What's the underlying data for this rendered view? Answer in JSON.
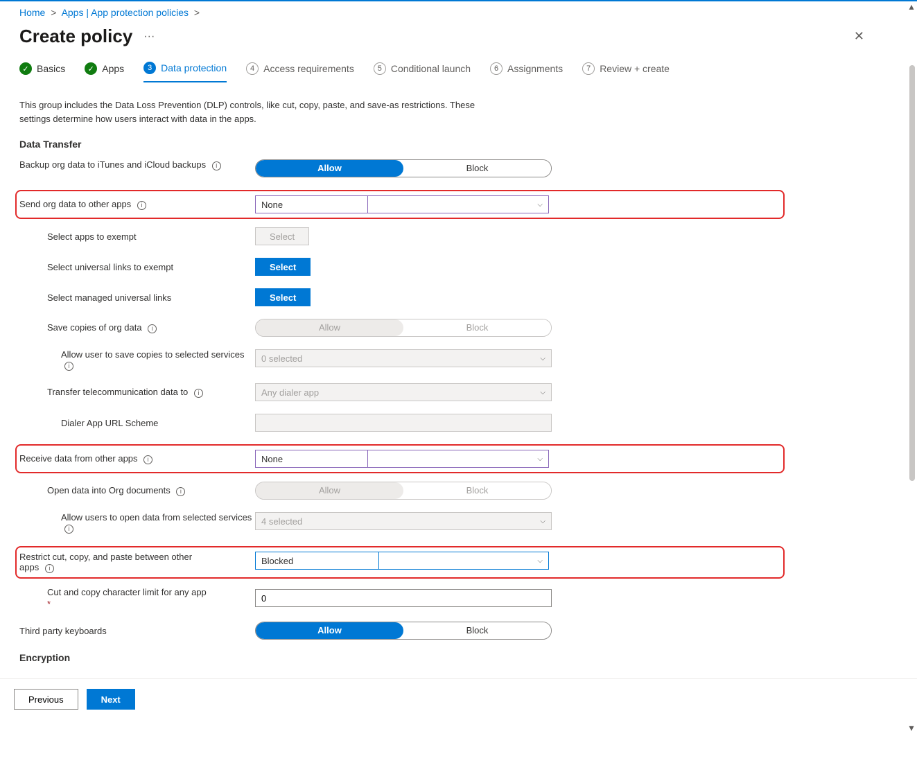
{
  "breadcrumb": {
    "home": "Home",
    "apps": "Apps | App protection policies"
  },
  "header": {
    "title": "Create policy"
  },
  "wizard": {
    "s1": "Basics",
    "s2": "Apps",
    "s3": "Data protection",
    "s4": "Access requirements",
    "s5": "Conditional launch",
    "s6": "Assignments",
    "s7": "Review + create",
    "n4": "4",
    "n5": "5",
    "n6": "6",
    "n7": "7",
    "n3": "3"
  },
  "desc": "This group includes the Data Loss Prevention (DLP) controls, like cut, copy, paste, and save-as restrictions. These settings determine how users interact with data in the apps.",
  "section": {
    "dataTransfer": "Data Transfer",
    "encryption": "Encryption"
  },
  "labels": {
    "backup": "Backup org data to iTunes and iCloud backups",
    "sendOrg": "Send org data to other apps",
    "appsExempt": "Select apps to exempt",
    "ulinksExempt": "Select universal links to exempt",
    "managedUlinks": "Select managed universal links",
    "saveCopies": "Save copies of org data",
    "allowSaveServices": "Allow user to save copies to selected services",
    "transferTele": "Transfer telecommunication data to",
    "dialerUrl": "Dialer App URL Scheme",
    "receiveData": "Receive data from other apps",
    "openOrg": "Open data into Org documents",
    "allowOpenServices": "Allow users to open data from selected services",
    "restrictCut": "Restrict cut, copy, and paste between other apps",
    "cutLimit": "Cut and copy character limit for any app",
    "thirdKb": "Third party keyboards"
  },
  "values": {
    "allow": "Allow",
    "block": "Block",
    "none": "None",
    "select": "Select",
    "zeroSelected": "0 selected",
    "anyDialer": "Any dialer app",
    "fourSelected": "4 selected",
    "blocked": "Blocked",
    "zero": "0"
  },
  "footer": {
    "previous": "Previous",
    "next": "Next"
  }
}
